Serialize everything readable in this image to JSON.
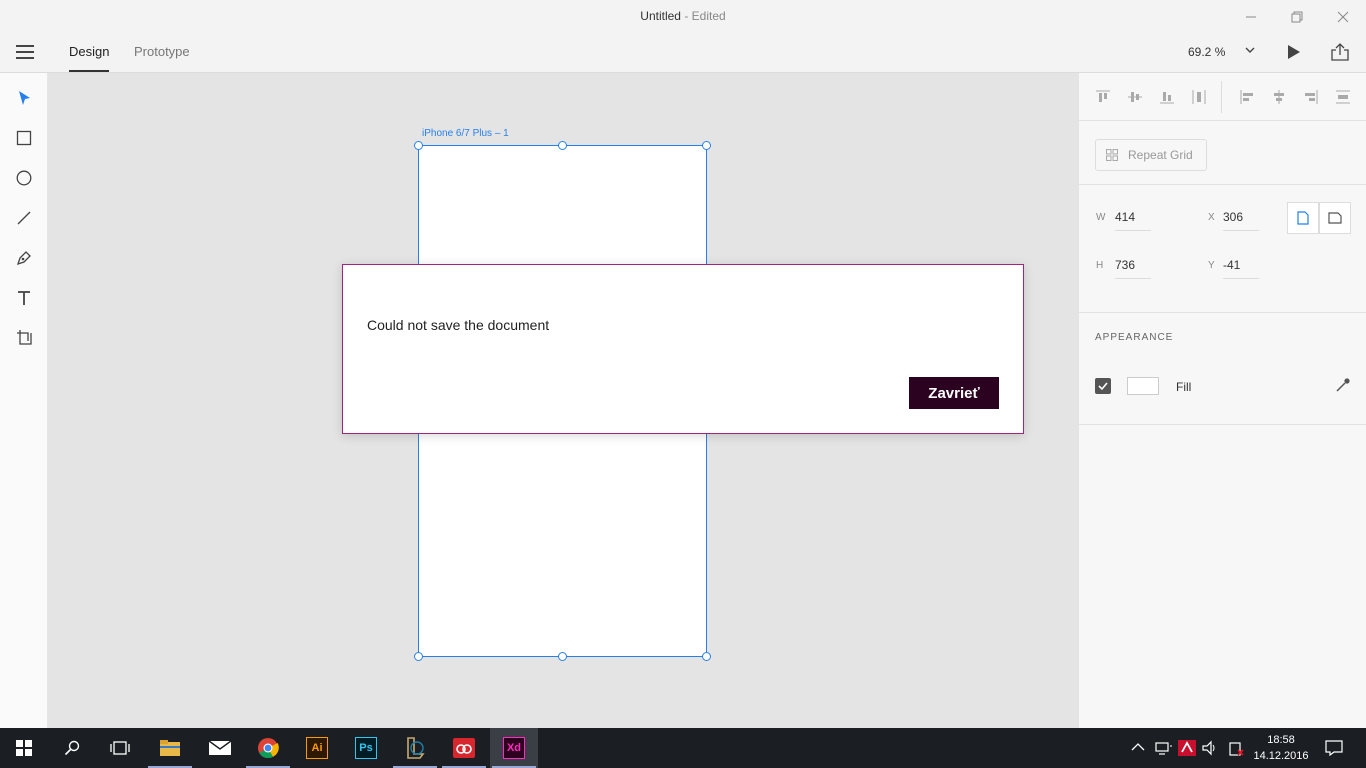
{
  "window": {
    "title": "Untitled",
    "status": " - Edited"
  },
  "menubar": {
    "tabs": [
      "Design",
      "Prototype"
    ],
    "zoom": "69.2 %"
  },
  "artboard": {
    "label": "iPhone 6/7 Plus – 1"
  },
  "panel": {
    "repeat_grid": "Repeat Grid",
    "w_label": "W",
    "w_value": "414",
    "x_label": "X",
    "x_value": "306",
    "h_label": "H",
    "h_value": "736",
    "y_label": "Y",
    "y_value": "-41",
    "appearance_title": "APPEARANCE",
    "fill_label": "Fill"
  },
  "dialog": {
    "message": "Could not save the document",
    "button": "Zavrieť"
  },
  "taskbar": {
    "apps": [
      "Ai",
      "Ps",
      "Xd"
    ],
    "time": "18:58",
    "date": "14.12.2016"
  },
  "colors": {
    "accent": "#2680eb",
    "dialog_border": "#a3247a",
    "dialog_button": "#2b0320"
  }
}
